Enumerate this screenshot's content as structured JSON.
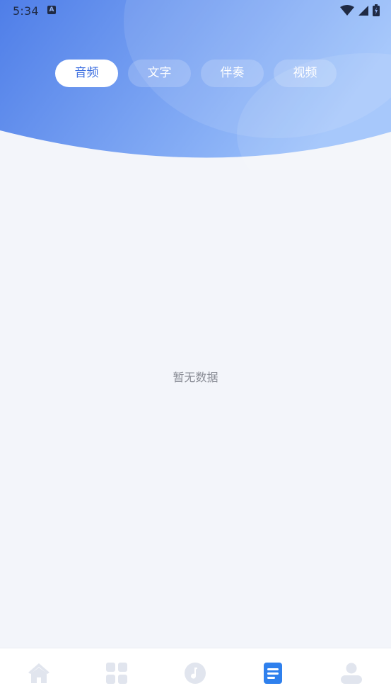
{
  "status_bar": {
    "time": "5:34",
    "notification_letter": "A"
  },
  "tabs": [
    {
      "label": "音频",
      "active": true
    },
    {
      "label": "文字",
      "active": false
    },
    {
      "label": "伴奏",
      "active": false
    },
    {
      "label": "视频",
      "active": false
    }
  ],
  "empty_state": {
    "message": "暂无数据"
  },
  "bottom_nav": {
    "items": [
      {
        "icon": "home-icon",
        "active": false
      },
      {
        "icon": "grid-icon",
        "active": false
      },
      {
        "icon": "music-note-icon",
        "active": false
      },
      {
        "icon": "document-list-icon",
        "active": true
      },
      {
        "icon": "user-icon",
        "active": false
      }
    ]
  },
  "colors": {
    "accent": "#3d6fe0",
    "header_start": "#4f7ee8",
    "header_end": "#9dc2fb",
    "background": "#f3f5fa",
    "nav_inactive": "#e1e5ee",
    "nav_active": "#2f80ed"
  }
}
